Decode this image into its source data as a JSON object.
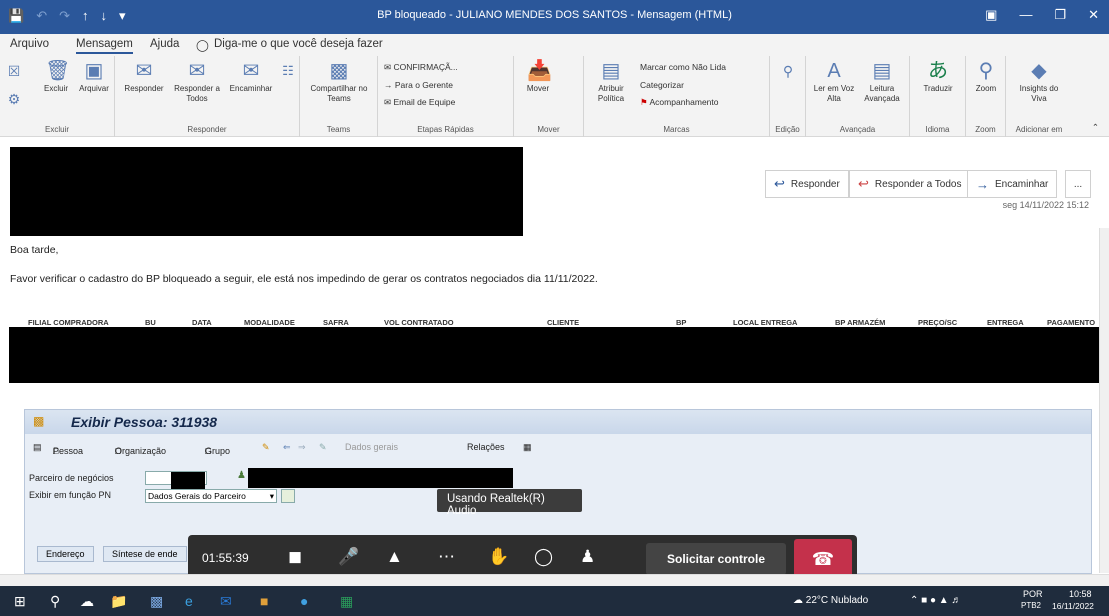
{
  "window": {
    "title": "BP bloqueado - JULIANO MENDES DOS SANTOS  -  Mensagem (HTML)"
  },
  "menu": {
    "items": [
      "Arquivo",
      "Mensagem",
      "Ajuda"
    ],
    "search_placeholder": "Diga-me o que você deseja fazer"
  },
  "ribbon": {
    "groups": {
      "excluir": "Excluir",
      "responder": "Responder",
      "teams": "Teams",
      "etapas": "Etapas Rápidas",
      "mover": "Mover",
      "marcas": "Marcas",
      "edicao": "Edição",
      "avancada": "Avançada",
      "idioma": "Idioma",
      "zoom": "Zoom",
      "adicionar": "Adicionar em"
    },
    "buttons": {
      "excluir": "Excluir",
      "arquivar": "Arquivar",
      "responder": "Responder",
      "responder_todos": "Responder a Todos",
      "encaminhar": "Encaminhar",
      "compartilhar": "Compartilhar no Teams",
      "confirmacao": "CONFIRMAÇÃ...",
      "para_gerente": "Para o Gerente",
      "email_equipe": "Email de Equipe",
      "mover": "Mover",
      "atribuir": "Atribuir Política",
      "marcar_nao_lida": "Marcar como Não Lida",
      "categorizar": "Categorizar",
      "acompanhamento": "Acompanhamento",
      "ler_alta": "Ler em Voz Alta",
      "leitura_avancada": "Leitura Avançada",
      "traduzir": "Traduzir",
      "zoom": "Zoom",
      "insights": "Insights do Viva"
    }
  },
  "message": {
    "actions": {
      "reply": "Responder",
      "reply_all": "Responder a Todos",
      "forward": "Encaminhar",
      "more": "..."
    },
    "date": "seg 14/11/2022 15:12",
    "greeting": "Boa tarde,",
    "body": "Favor verificar o cadastro do BP bloqueado a seguir, ele está nos impedindo de gerar os contratos negociados dia 11/11/2022.",
    "table_headers": [
      "FILIAL COMPRADORA",
      "BU",
      "DATA",
      "MODALIDADE",
      "SAFRA",
      "VOL CONTRATADO",
      "CLIENTE",
      "BP",
      "LOCAL ENTREGA",
      "BP ARMAZÉM",
      "PREÇO/SC",
      "ENTREGA",
      "PAGAMENTO"
    ]
  },
  "sap": {
    "title": "Exibir Pessoa: 311938",
    "toolbar": {
      "pessoa": "Pessoa",
      "organizacao": "Organização",
      "grupo": "Grupo",
      "dados_gerais": "Dados gerais",
      "relacoes": "Relações"
    },
    "fields": {
      "parceiro_label": "Parceiro de negócios",
      "exibir_label": "Exibir em função PN",
      "exibir_value": "Dados Gerais do Parceiro"
    },
    "tabs": [
      "Endereço",
      "Síntese de ende"
    ]
  },
  "tooltip": "Usando Realtek(R) Audio",
  "call": {
    "timer": "01:55:39",
    "request_control": "Solicitar controle"
  },
  "taskbar": {
    "weather": "22°C  Nublado",
    "lang": "POR",
    "lang2": "PTB2",
    "time": "10:58",
    "date": "16/11/2022"
  }
}
